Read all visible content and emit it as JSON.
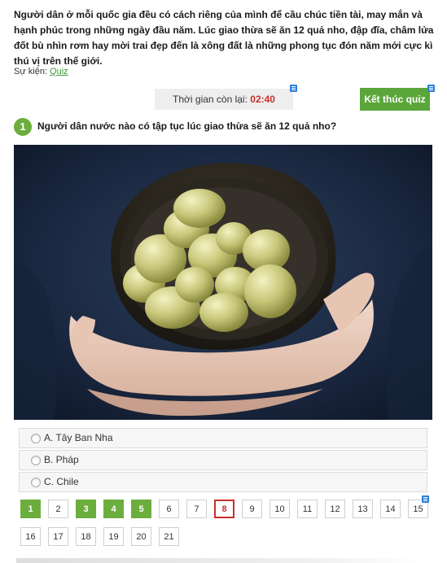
{
  "intro": {
    "text": "Người dân ở mỗi quốc gia đều có cách riêng của mình để cầu chúc tiền tài, may mắn và hạnh phúc trong những ngày đầu năm. Lúc giao thừa sẽ ăn 12 quả nho, đập đĩa, châm lửa đốt bù nhìn rơm hay mời trai đẹp đến là xông đất là những phong tục đón năm mới cực kì thú vị trên thế giới."
  },
  "event": {
    "label": "Sự kiện:",
    "link": "Quiz"
  },
  "timer": {
    "label": "Thời gian còn lại:",
    "value": "02:40"
  },
  "finish_button": "Kết thúc quiz",
  "question": {
    "number": "1",
    "text": "Người dân nước nào có tập tục lúc giao thừa sẽ ăn 12 quả nho?",
    "image_icon": "photo-bowl-of-grapes"
  },
  "answers": [
    {
      "label": "A. Tây Ban Nha"
    },
    {
      "label": "B. Pháp"
    },
    {
      "label": "C. Chile"
    }
  ],
  "pager": {
    "pages": [
      "1",
      "2",
      "3",
      "4",
      "5",
      "6",
      "7",
      "8",
      "9",
      "10",
      "11",
      "12",
      "13",
      "14",
      "15",
      "16",
      "17",
      "18",
      "19",
      "20",
      "21"
    ],
    "answered": [
      "1",
      "3",
      "4",
      "5"
    ],
    "current": "8"
  },
  "colors": {
    "accent_green": "#5aa63a",
    "timer_red": "#c9302c",
    "info_icon_blue": "#2d7fd6"
  }
}
